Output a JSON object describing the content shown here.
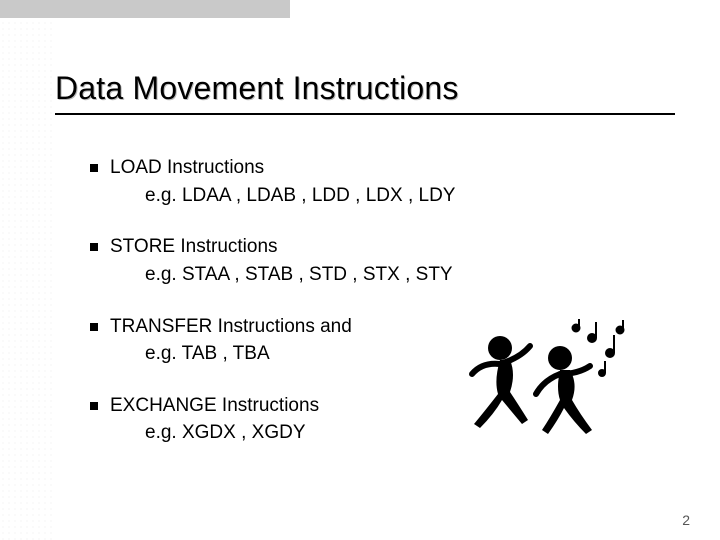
{
  "slide": {
    "title": "Data Movement Instructions",
    "bullets": [
      {
        "heading": "LOAD Instructions",
        "sub": "e.g. LDAA ,  LDAB ,  LDD ,  LDX ,  LDY"
      },
      {
        "heading": "STORE Instructions",
        "sub": "e.g. STAA ,  STAB ,  STD ,  STX ,  STY"
      },
      {
        "heading": "TRANSFER Instructions and",
        "sub": "e.g. TAB ,  TBA"
      },
      {
        "heading": "EXCHANGE Instructions",
        "sub": "e.g. XGDX ,  XGDY"
      }
    ],
    "page_number": "2",
    "clipart": {
      "name": "dancing-figures-music-notes",
      "alt": "Two cartoon dancing figures with music notes"
    }
  }
}
